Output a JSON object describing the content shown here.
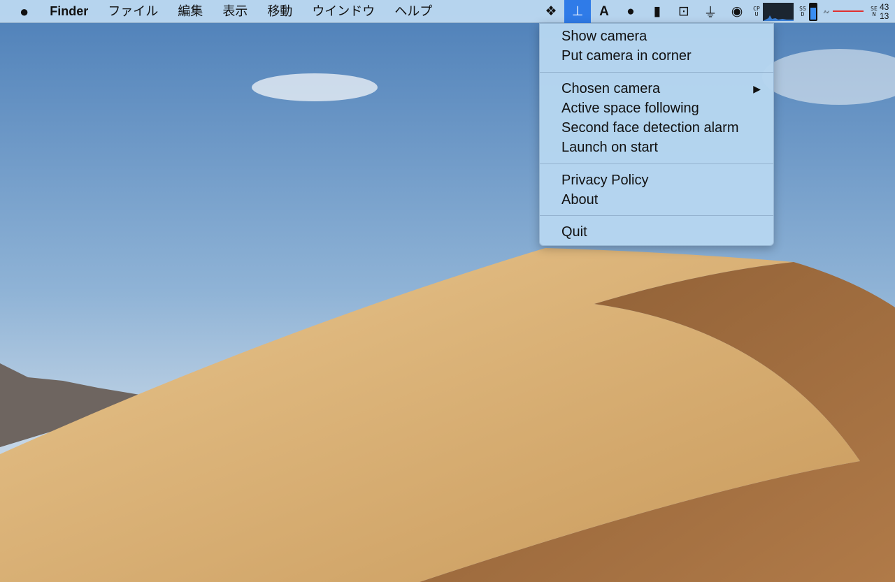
{
  "menubar": {
    "apple": "",
    "app": "Finder",
    "items": [
      "ファイル",
      "編集",
      "表示",
      "移動",
      "ウインドウ",
      "ヘルプ"
    ]
  },
  "status": {
    "icons": [
      "dropbox-icon",
      "camera-app-icon",
      "sync-a-icon",
      "bowler-hat-icon",
      "top-hat-icon",
      "download-box-icon",
      "duster-icon",
      "circle-sync-icon"
    ],
    "cpu_label": "CPU",
    "ssd_label": "SSD",
    "ssd_fill_percent": 75,
    "net_label": "⇗⇙",
    "sen_label": "SEN",
    "sen_values": [
      "43",
      "13"
    ]
  },
  "menu": {
    "groups": [
      [
        "Show camera",
        "Put camera in corner"
      ],
      [
        "Chosen camera",
        "Active space following",
        "Second face detection alarm",
        "Launch on start"
      ],
      [
        "Privacy Policy",
        "About"
      ],
      [
        "Quit"
      ]
    ],
    "submenu_arrow": "▶"
  }
}
